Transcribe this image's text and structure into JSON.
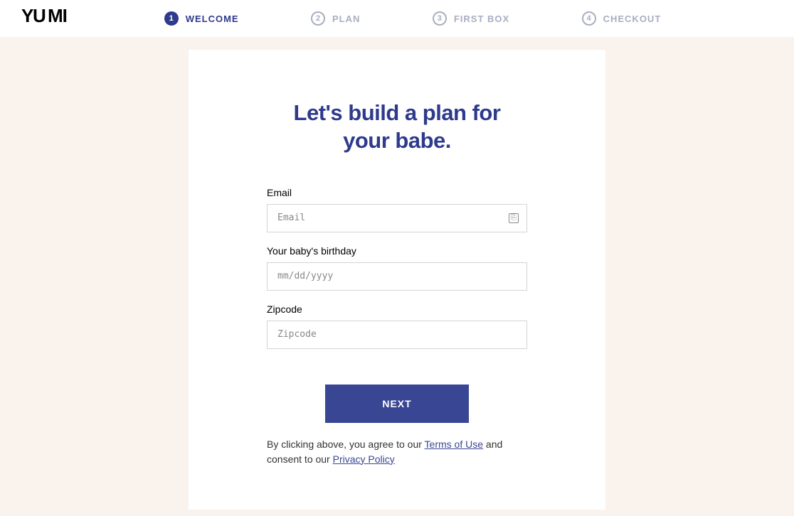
{
  "logo": "YUMI",
  "steps": [
    {
      "num": "1",
      "label": "WELCOME",
      "active": true
    },
    {
      "num": "2",
      "label": "PLAN",
      "active": false
    },
    {
      "num": "3",
      "label": "FIRST BOX",
      "active": false
    },
    {
      "num": "4",
      "label": "CHECKOUT",
      "active": false
    }
  ],
  "title_line1": "Let's build a plan for",
  "title_line2": "your babe.",
  "form": {
    "email_label": "Email",
    "email_placeholder": "Email",
    "birthday_label": "Your baby's birthday",
    "birthday_placeholder": "mm/dd/yyyy",
    "zipcode_label": "Zipcode",
    "zipcode_placeholder": "Zipcode"
  },
  "next_button": "NEXT",
  "consent": {
    "prefix": "By clicking above, you agree to our ",
    "terms": "Terms of Use",
    "middle": " and consent to our ",
    "privacy": "Privacy Policy"
  }
}
